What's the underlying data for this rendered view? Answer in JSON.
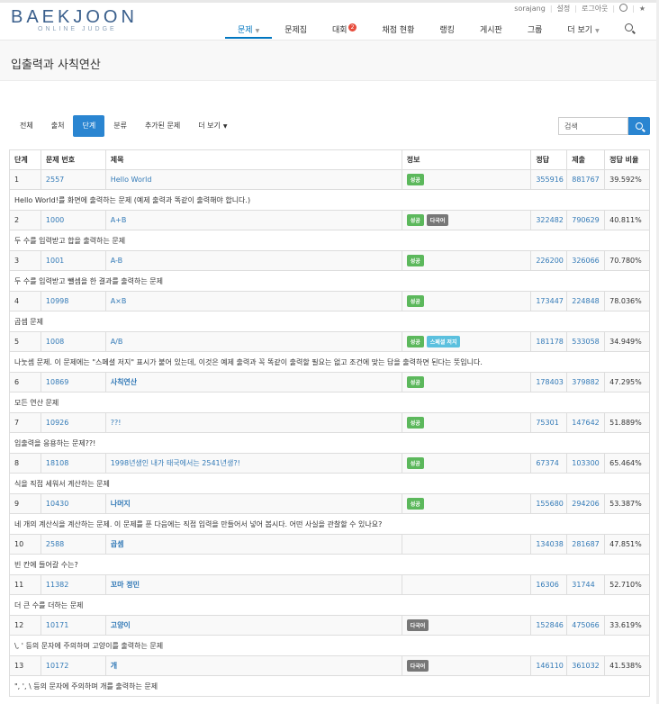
{
  "logo": {
    "main": "BAEKJOON",
    "sub": "ONLINE JUDGE"
  },
  "user_nav": {
    "username": "sorajang",
    "settings": "설정",
    "logout": "로그아웃"
  },
  "main_nav": {
    "problems": "문제",
    "workbook": "문제집",
    "contest": "대회",
    "contest_badge": "2",
    "status": "채점 현황",
    "ranking": "랭킹",
    "board": "게시판",
    "group": "그룹",
    "more": "더 보기"
  },
  "page_title": "입출력과 사칙연산",
  "tabs": {
    "all": "전체",
    "source": "출처",
    "step": "단계",
    "category": "분류",
    "added": "추가된 문제",
    "more": "더 보기"
  },
  "search": {
    "placeholder": "검색"
  },
  "table": {
    "headers": {
      "step": "단계",
      "problem_id": "문제 번호",
      "title": "제목",
      "info": "정보",
      "correct": "정답",
      "submissions": "제출",
      "ratio": "정답 비율"
    },
    "labels": {
      "success": "성공",
      "multi": "다국어",
      "special": "스페셜 저지"
    },
    "rows": [
      {
        "step": "1",
        "id": "2557",
        "title": "Hello World",
        "correct": "355916",
        "submissions": "881767",
        "ratio": "39.592%",
        "desc": "Hello World!를 화면에 출력하는 문제 (예제 출력과 똑같이 출력해야 합니다.)"
      },
      {
        "step": "2",
        "id": "1000",
        "title": "A+B",
        "correct": "322482",
        "submissions": "790629",
        "ratio": "40.811%",
        "desc": "두 수를 입력받고 합을 출력하는 문제"
      },
      {
        "step": "3",
        "id": "1001",
        "title": "A-B",
        "correct": "226200",
        "submissions": "326066",
        "ratio": "70.780%",
        "desc": "두 수를 입력받고 뺄셈을 한 결과를 출력하는 문제"
      },
      {
        "step": "4",
        "id": "10998",
        "title": "A×B",
        "correct": "173447",
        "submissions": "224848",
        "ratio": "78.036%",
        "desc": "곱셈 문제"
      },
      {
        "step": "5",
        "id": "1008",
        "title": "A/B",
        "correct": "181178",
        "submissions": "533058",
        "ratio": "34.949%",
        "desc": "나눗셈 문제. 이 문제에는 \"스페셜 저지\" 표시가 붙어 있는데, 이것은 예제 출력과 꼭 똑같이 출력할 필요는 없고 조건에 맞는 답을 출력하면 된다는 뜻입니다."
      },
      {
        "step": "6",
        "id": "10869",
        "title": "사칙연산",
        "correct": "178403",
        "submissions": "379882",
        "ratio": "47.295%",
        "desc": "모든 연산 문제"
      },
      {
        "step": "7",
        "id": "10926",
        "title": "??!",
        "correct": "75301",
        "submissions": "147642",
        "ratio": "51.889%",
        "desc": "입출력을 응용하는 문제??!"
      },
      {
        "step": "8",
        "id": "18108",
        "title": "1998년생인 내가 태국에서는 2541년생?!",
        "correct": "67374",
        "submissions": "103300",
        "ratio": "65.464%",
        "desc": "식을 직접 세워서 계산하는 문제"
      },
      {
        "step": "9",
        "id": "10430",
        "title": "나머지",
        "correct": "155680",
        "submissions": "294206",
        "ratio": "53.387%",
        "desc": "네 개의 계산식을 계산하는 문제. 이 문제를 푼 다음에는 직접 입력을 만들어서 넣어 봅시다. 어떤 사실을 관찰할 수 있나요?"
      },
      {
        "step": "10",
        "id": "2588",
        "title": "곱셈",
        "correct": "134038",
        "submissions": "281687",
        "ratio": "47.851%",
        "desc": "빈 칸에 들어갈 수는?"
      },
      {
        "step": "11",
        "id": "11382",
        "title": "꼬마 정민",
        "correct": "16306",
        "submissions": "31744",
        "ratio": "52.710%",
        "desc": "더 큰 수를 더하는 문제"
      },
      {
        "step": "12",
        "id": "10171",
        "title": "고양이",
        "correct": "152846",
        "submissions": "475066",
        "ratio": "33.619%",
        "desc": "\\, ' 등의 문자에 주의하며 고양이를 출력하는 문제"
      },
      {
        "step": "13",
        "id": "10172",
        "title": "개",
        "correct": "146110",
        "submissions": "361032",
        "ratio": "41.538%",
        "desc": "\", ', \\ 등의 문자에 주의하며 개를 출력하는 문제"
      }
    ]
  },
  "colors": {
    "accent": "#2a85d1",
    "link": "#337ab7",
    "success": "#5cb85c",
    "multi": "#777777",
    "special": "#5bc0de",
    "badge": "#e74c3c"
  }
}
